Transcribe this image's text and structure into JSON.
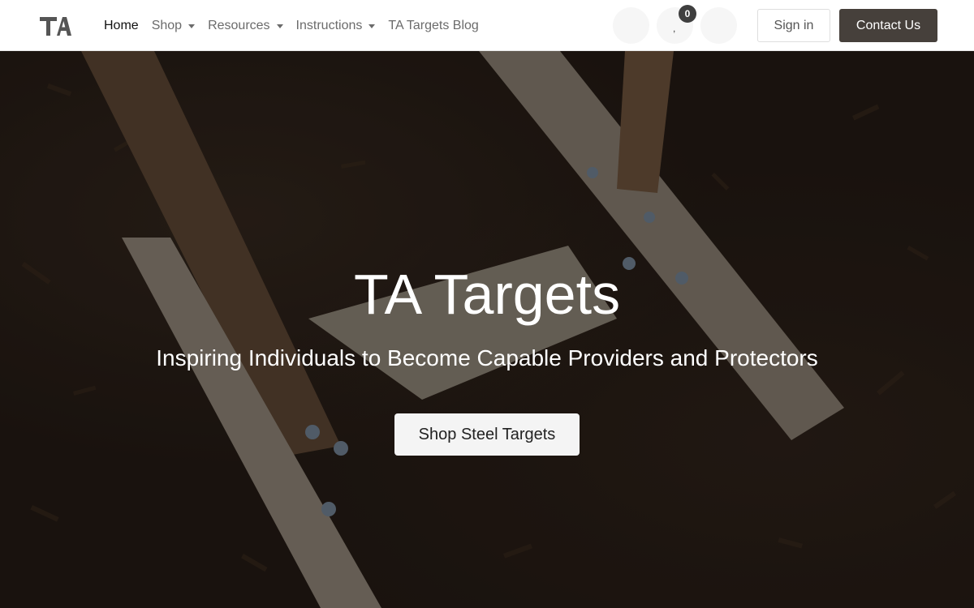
{
  "brand": {
    "logo_text": "TA"
  },
  "nav": {
    "items": [
      {
        "label": "Home",
        "active": true,
        "dropdown": false
      },
      {
        "label": "Shop",
        "active": false,
        "dropdown": true
      },
      {
        "label": "Resources",
        "active": false,
        "dropdown": true
      },
      {
        "label": "Instructions",
        "active": false,
        "dropdown": true
      },
      {
        "label": "TA Targets Blog",
        "active": false,
        "dropdown": false
      }
    ]
  },
  "header_actions": {
    "cart_count": "0",
    "cart_separator": ",",
    "signin_label": "Sign in",
    "contact_label": "Contact Us"
  },
  "hero": {
    "title": "TA Targets",
    "subtitle": "Inspiring Individuals to Become Capable Providers and Protectors",
    "cta_label": "Shop Steel Targets"
  },
  "colors": {
    "header_bg": "#ffffff",
    "contact_button_bg": "#46403b",
    "hero_overlay": "#1c1511",
    "cta_bg": "#f4f4f4"
  }
}
